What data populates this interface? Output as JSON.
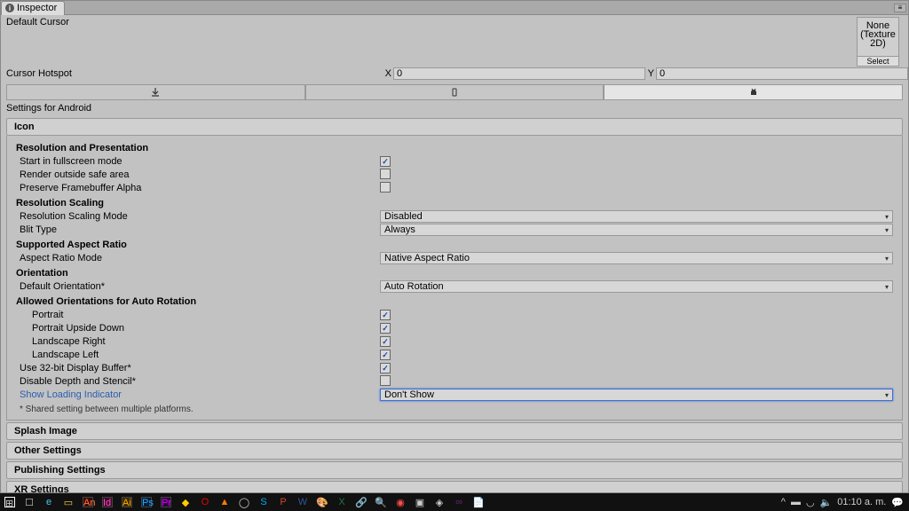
{
  "tab": {
    "title": "Inspector"
  },
  "cursor": {
    "default_label": "Default Cursor",
    "thumb_line1": "None",
    "thumb_line2": "(Texture",
    "thumb_line3": "2D)",
    "thumb_select": "Select",
    "hotspot_label": "Cursor Hotspot",
    "x_label": "X",
    "x_value": "0",
    "y_label": "Y",
    "y_value": "0"
  },
  "settings_for": "Settings for Android",
  "sections": {
    "icon": "Icon",
    "splash": "Splash Image",
    "other": "Other Settings",
    "publishing": "Publishing Settings",
    "xr": "XR Settings"
  },
  "res": {
    "header": "Resolution and Presentation",
    "start_fullscreen": "Start in fullscreen mode",
    "render_safe": "Render outside safe area",
    "preserve_alpha": "Preserve Framebuffer Alpha",
    "scaling_hdr": "Resolution Scaling",
    "scaling_mode_lbl": "Resolution Scaling Mode",
    "scaling_mode_val": "Disabled",
    "blit_lbl": "Blit Type",
    "blit_val": "Always",
    "aspect_hdr": "Supported Aspect Ratio",
    "aspect_mode_lbl": "Aspect Ratio Mode",
    "aspect_mode_val": "Native Aspect Ratio",
    "orient_hdr": "Orientation",
    "default_orient_lbl": "Default Orientation*",
    "default_orient_val": "Auto Rotation",
    "allowed_hdr": "Allowed Orientations for Auto Rotation",
    "portrait": "Portrait",
    "portrait_ud": "Portrait Upside Down",
    "land_r": "Landscape Right",
    "land_l": "Landscape Left",
    "use32": "Use 32-bit Display Buffer*",
    "disable_depth": "Disable Depth and Stencil*",
    "loading_ind": "Show Loading Indicator",
    "loading_val": "Don't Show",
    "footnote": "* Shared setting between multiple platforms."
  },
  "checks": {
    "start_fullscreen": true,
    "render_safe": false,
    "preserve_alpha": false,
    "portrait": true,
    "portrait_ud": true,
    "land_r": true,
    "land_l": true,
    "use32": true,
    "disable_depth": false
  },
  "taskbar": {
    "time": "01:10 a. m."
  }
}
